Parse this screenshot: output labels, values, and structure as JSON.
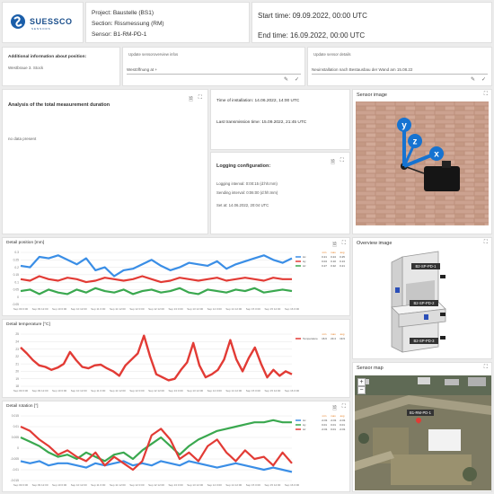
{
  "header": {
    "logo_text": "SUESSCO",
    "logo_sub": "SENSORS",
    "project": "Project: Baustelle (BS1)",
    "section": "Section: Rissmessung (RM)",
    "sensor": "Sensor: B1-RM-PD-1",
    "start_time": "Start time: 09.09.2022, 00:00 UTC",
    "end_time": "End time: 16.09.2022, 00:00 UTC"
  },
  "info_row": {
    "position_label": "Additional information about position:",
    "position_value": "Westbraue 3. Stock",
    "overview_label": "Update sensoroverview infos",
    "overview_value": "Westöffnung at +",
    "details_label": "Update sensor details",
    "details_value": "Neuinstallation nach Bestausbau der Wand am 15.08.22"
  },
  "analysis": {
    "title": "Analysis of the total measurement duration",
    "value": "no data present"
  },
  "install": {
    "time_of_installation": "Time of installation: 14.06.2022, 14:00 UTC",
    "last_transmission": "Last transmission time: 15.09.2022, 21:45 UTC"
  },
  "logging": {
    "title": "Logging configuration:",
    "logging_interval": "Logging interval: 0:00:15 (d:hh:mm)",
    "sending_interval": "Sending interval: 0:06:00 (d:hh:mm)",
    "set_at": "Set at: 14.06.2022, 20:04 UTC"
  },
  "sensor_image": {
    "title": "Sensor image",
    "axis_y": "y",
    "axis_z": "z",
    "axis_x": "x"
  },
  "overview_image": {
    "title": "Overview image",
    "tags": [
      "B2-SP-PD-1",
      "B2-SP-PD-2",
      "B2-SP-PD-3"
    ]
  },
  "sensor_map": {
    "title": "Sensor map",
    "marker_label": "B1-RM-PD-1",
    "zoom_in": "+",
    "zoom_out": "−"
  },
  "charts_meta": {
    "col_min": "min",
    "col_max": "max",
    "col_avg": "avg"
  },
  "colors": {
    "blue": "#3a8ee6",
    "green": "#3aa84f",
    "red": "#e23b35",
    "brick": "#b87a62"
  },
  "chart_data": [
    {
      "type": "line",
      "title": "Detail position [mm]",
      "x": [
        "Sep 09 0:00",
        "Sep 09 12:00",
        "Sep 10 0:00",
        "Sep 10 12:00",
        "Sep 11 0:00",
        "Sep 11 12:00",
        "Sep 12 0:00",
        "Sep 12 12:00",
        "Sep 13 0:00",
        "Sep 13 12:00",
        "Sep 14 0:00",
        "Sep 14 12:00",
        "Sep 15 0:00",
        "Sep 15 12:00",
        "Sep 16 0:00"
      ],
      "yticks": [
        "0.3",
        "0.25",
        "0.2",
        "0.15",
        "0.1",
        "0.05",
        "0",
        "-0.05"
      ],
      "ylim": [
        -0.05,
        0.3
      ],
      "series": [
        {
          "name": "Δx",
          "color": "#3a8ee6",
          "min": "0.21",
          "max": "0.24",
          "avg": "0.25",
          "values": [
            0.21,
            0.2,
            0.27,
            0.26,
            0.28,
            0.25,
            0.22,
            0.26,
            0.18,
            0.2,
            0.14,
            0.18,
            0.19,
            0.22,
            0.25,
            0.21,
            0.18,
            0.2,
            0.23,
            0.22,
            0.21,
            0.24,
            0.19,
            0.22,
            0.24,
            0.26,
            0.28,
            0.25,
            0.23,
            0.26
          ]
        },
        {
          "name": "Δy",
          "color": "#e23b35",
          "min": "0.04",
          "max": "0.10",
          "avg": "0.13",
          "values": [
            0.12,
            0.11,
            0.14,
            0.12,
            0.11,
            0.13,
            0.12,
            0.1,
            0.11,
            0.13,
            0.12,
            0.11,
            0.12,
            0.14,
            0.12,
            0.1,
            0.11,
            0.13,
            0.12,
            0.11,
            0.12,
            0.13,
            0.11,
            0.12,
            0.13,
            0.12,
            0.11,
            0.13,
            0.12,
            0.12
          ]
        },
        {
          "name": "Δz",
          "color": "#3aa84f",
          "min": "0.27",
          "max": "0.32",
          "avg": "0.21",
          "values": [
            0.04,
            0.05,
            0.02,
            0.05,
            0.03,
            0.02,
            0.05,
            0.03,
            0.06,
            0.04,
            0.03,
            0.05,
            0.02,
            0.04,
            0.05,
            0.03,
            0.04,
            0.06,
            0.03,
            0.02,
            0.05,
            0.04,
            0.03,
            0.05,
            0.04,
            0.06,
            0.03,
            0.04,
            0.05,
            0.04
          ]
        }
      ]
    },
    {
      "type": "line",
      "title": "Detail temperature [°C]",
      "x": [
        "Sep 09 0:00",
        "Sep 09 12:00",
        "Sep 10 0:00",
        "Sep 10 12:00",
        "Sep 11 0:00",
        "Sep 11 12:00",
        "Sep 12 0:00",
        "Sep 12 12:00",
        "Sep 13 0:00",
        "Sep 13 12:00",
        "Sep 14 0:00",
        "Sep 14 12:00",
        "Sep 15 0:00",
        "Sep 15 12:00",
        "Sep 16 0:00"
      ],
      "yticks": [
        "25",
        "24",
        "23",
        "22",
        "21",
        "20",
        "19",
        "18"
      ],
      "ylim": [
        18,
        25
      ],
      "series": [
        {
          "name": "Temperature",
          "color": "#e23b35",
          "min": "16.6",
          "max": "23.4",
          "avg": "19.9",
          "values": [
            23.2,
            22.4,
            21.5,
            20.8,
            20.6,
            20.2,
            20.5,
            21.0,
            22.6,
            21.5,
            20.6,
            20.4,
            20.8,
            20.9,
            20.4,
            20.0,
            19.4,
            20.8,
            21.6,
            22.4,
            24.8,
            22.0,
            19.6,
            19.2,
            18.8,
            19.0,
            20.2,
            21.2,
            23.8,
            20.8,
            19.2,
            19.6,
            20.2,
            21.6,
            24.2,
            21.6,
            20.0,
            21.8,
            23.2,
            21.0,
            19.2,
            20.2,
            19.4,
            20.0,
            19.6
          ]
        }
      ]
    },
    {
      "type": "line",
      "title": "Detail rotation [°]",
      "x": [
        "Sep 09 0:00",
        "Sep 09 12:00",
        "Sep 10 0:00",
        "Sep 10 12:00",
        "Sep 11 0:00",
        "Sep 11 12:00",
        "Sep 12 0:00",
        "Sep 12 12:00",
        "Sep 13 0:00",
        "Sep 13 12:00",
        "Sep 14 0:00",
        "Sep 14 12:00",
        "Sep 15 0:00",
        "Sep 15 12:00",
        "Sep 16 0:00"
      ],
      "yticks": [
        "0.015",
        "0.01",
        "0.005",
        "0",
        "-0.005",
        "-0.01",
        "-0.015"
      ],
      "ylim": [
        -0.015,
        0.015
      ],
      "series": [
        {
          "name": "Δx",
          "color": "#3a8ee6",
          "min": "-0.01",
          "max": "-0.01",
          "avg": "-0.01",
          "values": [
            -0.006,
            -0.007,
            -0.006,
            -0.008,
            -0.007,
            -0.007,
            -0.008,
            -0.009,
            -0.007,
            -0.008,
            -0.007,
            -0.006,
            -0.008,
            -0.007,
            -0.008,
            -0.006,
            -0.007,
            -0.008,
            -0.006,
            -0.007,
            -0.008,
            -0.009,
            -0.008,
            -0.007,
            -0.008,
            -0.009,
            -0.01,
            -0.009,
            -0.01,
            -0.011
          ]
        },
        {
          "name": "Δy",
          "color": "#3aa84f",
          "min": "0.01",
          "max": "0.01",
          "avg": "0.01",
          "values": [
            0.005,
            0.003,
            0.001,
            -0.002,
            -0.004,
            -0.003,
            -0.005,
            -0.002,
            -0.004,
            -0.006,
            -0.003,
            -0.002,
            -0.005,
            -0.001,
            0.002,
            0.005,
            0.001,
            -0.003,
            0.001,
            0.004,
            0.006,
            0.008,
            0.009,
            0.01,
            0.011,
            0.012,
            0.012,
            0.013,
            0.012,
            0.012
          ]
        },
        {
          "name": "Δz",
          "color": "#e23b35",
          "min": "-0.01",
          "max": "0.01",
          "avg": "-0.01",
          "values": [
            0.01,
            0.008,
            0.004,
            0.001,
            -0.003,
            -0.001,
            -0.004,
            -0.006,
            -0.002,
            -0.008,
            -0.004,
            -0.007,
            -0.01,
            -0.006,
            0.006,
            0.009,
            0.004,
            -0.005,
            -0.002,
            -0.006,
            0.001,
            0.004,
            -0.002,
            -0.006,
            -0.001,
            -0.005,
            -0.004,
            -0.008,
            -0.002,
            -0.007
          ]
        }
      ]
    }
  ]
}
